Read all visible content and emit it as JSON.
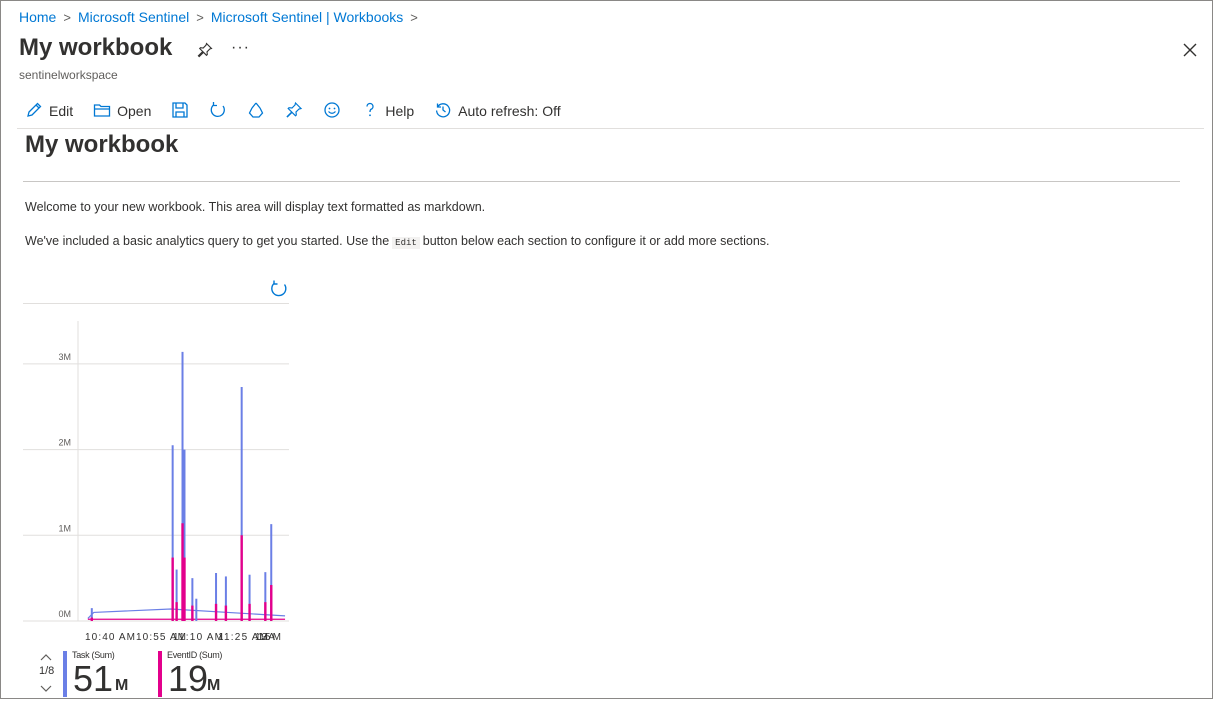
{
  "breadcrumb": {
    "items": [
      "Home",
      "Microsoft Sentinel",
      "Microsoft Sentinel | Workbooks"
    ],
    "separator": ">"
  },
  "header": {
    "title": "My workbook",
    "subtitle": "sentinelworkspace",
    "more_label": "···"
  },
  "toolbar": {
    "edit_label": "Edit",
    "open_label": "Open",
    "help_label": "Help",
    "autorefresh_label": "Auto refresh: Off"
  },
  "content": {
    "title": "My workbook",
    "paragraph1": "Welcome to your new workbook. This area will display text formatted as markdown.",
    "paragraph2_pre": "We've included a basic analytics query to get you started. Use the",
    "paragraph2_code": "Edit",
    "paragraph2_post": "button below each section to configure it or add more sections."
  },
  "chart_data": {
    "type": "line",
    "ylim": [
      0,
      3500000
    ],
    "yticks": [
      "0M",
      "1M",
      "2M",
      "3M"
    ],
    "xticks": [
      "10:40 AM",
      "10:55 AM",
      "11:10 AM",
      "11:25 AM",
      "11:35 AM"
    ],
    "series": [
      {
        "name": "Task (Sum)",
        "color": "#6b7fe6",
        "spikes": [
          [
            10.62,
            150000
          ],
          [
            11.03,
            2050000
          ],
          [
            11.05,
            600000
          ],
          [
            11.08,
            3140000
          ],
          [
            11.09,
            2000000
          ],
          [
            11.13,
            500000
          ],
          [
            11.15,
            260000
          ],
          [
            11.25,
            560000
          ],
          [
            11.3,
            520000
          ],
          [
            11.38,
            2730000
          ],
          [
            11.42,
            540000
          ],
          [
            11.5,
            570000
          ],
          [
            11.53,
            1130000
          ]
        ]
      },
      {
        "name": "EventID (Sum)",
        "color": "#e3008c",
        "spikes": [
          [
            10.62,
            40000
          ],
          [
            11.03,
            740000
          ],
          [
            11.05,
            220000
          ],
          [
            11.08,
            1140000
          ],
          [
            11.09,
            740000
          ],
          [
            11.13,
            180000
          ],
          [
            11.25,
            200000
          ],
          [
            11.3,
            180000
          ],
          [
            11.38,
            1000000
          ],
          [
            11.42,
            200000
          ],
          [
            11.5,
            220000
          ],
          [
            11.53,
            420000
          ]
        ]
      }
    ],
    "legend": {
      "pager": "1/8",
      "items": [
        {
          "name": "Task (Sum)",
          "value": "51",
          "unit": "M",
          "color": "#6b7fe6"
        },
        {
          "name": "EventID (Sum)",
          "value": "19",
          "unit": "M",
          "color": "#e3008c"
        }
      ]
    }
  }
}
